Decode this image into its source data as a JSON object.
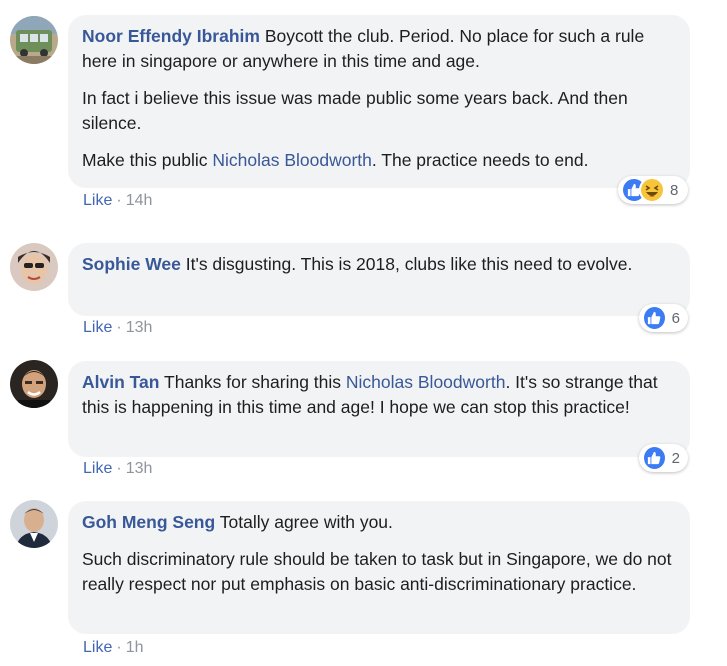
{
  "comments": [
    {
      "author": "Noor Effendy Ibrahim",
      "paragraphs": [
        "Boycott the club. Period. No place for such a rule here in singapore or anywhere in this time and age.",
        "In fact i believe this issue was made public some years back. And then silence."
      ],
      "mention_prefix": "Make this public ",
      "mention": "Nicholas Bloodworth",
      "mention_suffix": ". The practice needs to end.",
      "like_label": "Like",
      "separator": "·",
      "time": "14h",
      "reaction_count": "8",
      "reactions": [
        "like-icon",
        "haha-icon"
      ]
    },
    {
      "author": "Sophie Wee",
      "text": "It's disgusting. This is 2018, clubs like this need to evolve.",
      "like_label": "Like",
      "separator": "·",
      "time": "13h",
      "reaction_count": "6",
      "reactions": [
        "like-icon"
      ]
    },
    {
      "author": "Alvin Tan",
      "text_prefix": "Thanks for sharing this ",
      "mention": "Nicholas Bloodworth",
      "text_suffix": ". It's so strange that this is happening in this time and age! I hope we can stop this practice!",
      "like_label": "Like",
      "separator": "·",
      "time": "13h",
      "reaction_count": "2",
      "reactions": [
        "like-icon"
      ]
    },
    {
      "author": "Goh Meng Seng",
      "text": "Totally agree with you.",
      "paragraph2": "Such discriminatory rule should be taken to task but in Singapore, we do not really respect nor put emphasis on basic anti-discriminationary practice.",
      "like_label": "Like",
      "separator": "·",
      "time": "1h"
    }
  ],
  "colors": {
    "author_link": "#385898",
    "like_link": "#4267b2",
    "bubble_bg": "#f2f3f5",
    "meta_gray": "#90949c",
    "like_reaction": "#3b7cf5",
    "haha_reaction": "#f7c53b"
  }
}
